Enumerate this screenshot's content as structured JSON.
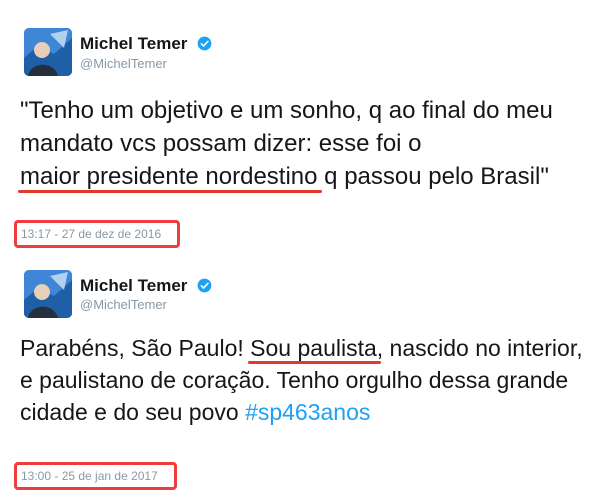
{
  "tweets": [
    {
      "author": {
        "name": "Michel Temer",
        "handle": "@MichelTemer",
        "avatar_icon": "temer-avatar-icon",
        "verified_icon": "verified-badge-icon"
      },
      "text_before": "\"Tenho um objetivo e um sonho, q ao final do meu mandato vcs possam dizer: esse foi o ",
      "text_highlight": "maior presidente nordestino",
      "text_after": " q passou pelo Brasil\"",
      "timestamp": "13:17 - 27 de dez de 2016"
    },
    {
      "author": {
        "name": "Michel Temer",
        "handle": "@MichelTemer",
        "avatar_icon": "temer-avatar-icon",
        "verified_icon": "verified-badge-icon"
      },
      "text_before": "Parabéns, São Paulo! ",
      "text_highlight": "Sou paulista",
      "text_after": ", nascido no interior, e paulistano de coração. Tenho orgulho dessa grande cidade e do seu povo ",
      "hashtag": "#sp463anos",
      "timestamp": "13:00 - 25 de jan de 2017"
    }
  ],
  "colors": {
    "highlight_underline": "#e03a2a",
    "timestamp_frame": "#ef3c3c",
    "hashtag": "#1da1f2",
    "verified": "#1da1f2"
  }
}
